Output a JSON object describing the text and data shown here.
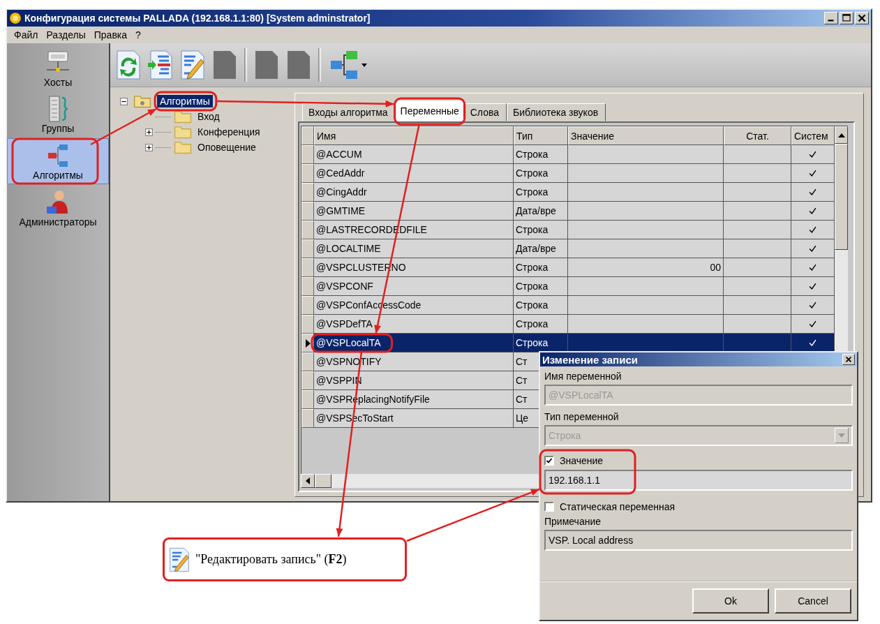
{
  "window": {
    "title": "Конфигурация системы PALLADA (192.168.1.1:80) [System adminstrator]"
  },
  "menu": [
    "Файл",
    "Разделы",
    "Правка",
    "?"
  ],
  "sidebar": {
    "items": [
      {
        "label": "Хосты",
        "kind": "server",
        "selected": false
      },
      {
        "label": "Группы",
        "kind": "group",
        "selected": false
      },
      {
        "label": "Алгоритмы",
        "kind": "diagram",
        "selected": true
      },
      {
        "label": "Администраторы",
        "kind": "user",
        "selected": false
      }
    ]
  },
  "toolbar": {
    "groups": [
      [
        {
          "kind": "refresh",
          "disabled": false
        },
        {
          "kind": "add",
          "disabled": false
        },
        {
          "kind": "edit",
          "disabled": false
        },
        {
          "kind": "page",
          "disabled": true
        }
      ],
      [
        {
          "kind": "page",
          "disabled": true
        },
        {
          "kind": "page",
          "disabled": true
        }
      ],
      [
        {
          "kind": "diagram",
          "disabled": false,
          "dropdown": true
        }
      ]
    ]
  },
  "tree": {
    "label": "Алгоритмы",
    "selected": true,
    "expanded": true,
    "children": [
      {
        "label": "Вход",
        "selected": false
      },
      {
        "label": "Конференция",
        "selected": false,
        "expanded": false
      },
      {
        "label": "Оповещение",
        "selected": false,
        "expanded": false
      }
    ]
  },
  "tabs": [
    {
      "label": "Входы алгоритма",
      "selected": false
    },
    {
      "label": "Переменные",
      "selected": true
    },
    {
      "label": "Слова",
      "selected": false
    },
    {
      "label": "Библиотека звуков",
      "selected": false
    }
  ],
  "table": {
    "columns": [
      "Имя",
      "Тип",
      "Значение",
      "Стат.",
      "Систем"
    ],
    "rows": [
      {
        "name": "@ACCUM",
        "type": "Строка",
        "system": true,
        "selected": false
      },
      {
        "name": "@CedAddr",
        "type": "Строка",
        "system": true,
        "selected": false
      },
      {
        "name": "@CingAddr",
        "type": "Строка",
        "system": true,
        "selected": false
      },
      {
        "name": "@GMTIME",
        "type": "Дата/вре",
        "system": true,
        "selected": false
      },
      {
        "name": "@LASTRECORDEDFILE",
        "type": "Строка",
        "system": true,
        "selected": false
      },
      {
        "name": "@LOCALTIME",
        "type": "Дата/вре",
        "system": true,
        "selected": false
      },
      {
        "name": "@VSPCLUSTERNO",
        "type": "Строка",
        "value": "00",
        "system": true,
        "selected": false
      },
      {
        "name": "@VSPCONF",
        "type": "Строка",
        "system": true,
        "selected": false
      },
      {
        "name": "@VSPConfAccessCode",
        "type": "Строка",
        "system": true,
        "selected": false
      },
      {
        "name": "@VSPDefTA",
        "type": "Строка",
        "system": true,
        "selected": false
      },
      {
        "name": "@VSPLocalTA",
        "type": "Строка",
        "system": true,
        "selected": true
      },
      {
        "name": "@VSPNOTIFY",
        "type": "Ст",
        "selected": false
      },
      {
        "name": "@VSPPIN",
        "type": "Ст",
        "selected": false
      },
      {
        "name": "@VSPReplacingNotifyFile",
        "type": "Ст",
        "selected": false
      },
      {
        "name": "@VSPSecToStart",
        "type": "Це",
        "selected": false
      }
    ]
  },
  "dialog": {
    "title": "Изменение записи",
    "name_label": "Имя переменной",
    "name_value": "@VSPLocalTA",
    "name_disabled": true,
    "type_label": "Тип переменной",
    "type_value": "Строка",
    "type_disabled": true,
    "value_checkbox": {
      "label": "Значение",
      "checked": true
    },
    "value": "192.168.1.1",
    "static_checkbox": {
      "label": "Статическая переменная",
      "checked": false
    },
    "note_label": "Примечание",
    "note_value": "VSP. Local address",
    "buttons": [
      "Ok",
      "Cancel"
    ]
  },
  "callout": {
    "text": "\"Редактировать запись\" (**F2**)"
  }
}
